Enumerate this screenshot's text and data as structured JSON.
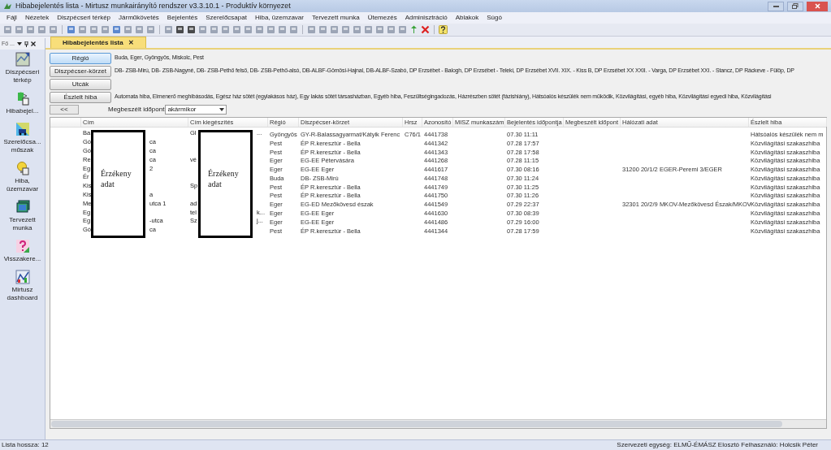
{
  "window": {
    "title": "Hibabejelentés lista - Mirtusz munkairányító rendszer v3.3.10.1 - Produktív környezet"
  },
  "menu": [
    "Fájl",
    "Nézetek",
    "Diszpécseri térkép",
    "Járműkövetés",
    "Bejelentés",
    "Szerelőcsapat",
    "Hiba, üzemzavar",
    "Tervezett munka",
    "Ütemezés",
    "Adminisztráció",
    "Ablakok",
    "Súgó"
  ],
  "sidebar": {
    "title": "Fő ...",
    "items": [
      {
        "label": "Diszpécseri térkép",
        "kind": "map"
      },
      {
        "label": "Hibabejel...",
        "kind": "report"
      },
      {
        "label": "Szerelőcsa... műszak",
        "kind": "truck"
      },
      {
        "label": "Hiba, üzemzavar",
        "kind": "bulb"
      },
      {
        "label": "Tervezett munka",
        "kind": "layers"
      },
      {
        "label": "Visszakere...",
        "kind": "question"
      },
      {
        "label": "Mirtusz dashboard",
        "kind": "chart"
      }
    ]
  },
  "tabs": [
    {
      "label": "Hibabejelentés lista",
      "selected": true,
      "close": "✕"
    }
  ],
  "filters": [
    {
      "button": "Régió",
      "value": "Buda, Eger, Gyöngyös, Miskolc, Pest",
      "selected": true
    },
    {
      "button": "Diszpécser-körzet",
      "value": "DB- ZSB-Mirú, DB- ZSB-Nagyné, DB- ZSB-Pethő felső, DB- ZSB-Pethő-alsó, DB-ALBF-Gömösi-Hajnal, DB-ALBF-Szabó, DP Erzsébet - Balogh, DP Erzsébet - Teleki, DP Erzsébet XVII. XIX. - Kiss B, DP Erzsébet XX XXII. - Varga, DP Erzsébet XXI. - Stancz, DP Ráckeve - Fülöp, DP",
      "selected": false
    },
    {
      "button": "Utcák",
      "selected": false
    },
    {
      "button": "Észlelt hiba",
      "value": "Automata hiba, Elmenerő meghibásodás, Egész ház sötét (egylakásos ház), Egy lakás sötét társasházban, Egyéb hiba, Feszültségingadozás, Házrészben sötét (fázishiány), Hátsóalós készülék nem működik, Közvilágítási, egyéb hiba, Közvilágítási egyedi hiba, Közvilágítási",
      "selected": false
    }
  ],
  "collapse_button": "<<",
  "date_filter": {
    "label": "Megbeszélt időpont",
    "value": "akármikor"
  },
  "table": {
    "columns": [
      "Cím",
      "Cím kiegészítés",
      "Régió",
      "Diszpécser-körzet",
      "Hrsz",
      "Azonosító",
      "MISZ munkaszám",
      "Bejelentés időpontja",
      "Megbeszélt időpont",
      "Hálózati adat",
      "Észlelt hiba"
    ],
    "rows": [
      {
        "cim": {
          "start": "Ba"
        },
        "kieg": {
          "start": "Gl",
          "end": "..."
        },
        "regio": "Gyöngyös",
        "korzet": "GY-R-Balassagyarmat/Kátyik Ferenc",
        "hrsz": "C76/1",
        "azon": "4441738",
        "bej": "07.30 11:11",
        "hiba": "Hátsóalós készülék nem m"
      },
      {
        "cim": {
          "start": "Gó",
          "end": "ca"
        },
        "regio": "Pest",
        "korzet": "ÉP R.keresztúr - Bella",
        "azon": "4441342",
        "bej": "07.28 17:57",
        "hiba": "Közvilágítási szakaszhiba"
      },
      {
        "cim": {
          "start": "Gó",
          "end": "ca"
        },
        "regio": "Pest",
        "korzet": "ÉP R.keresztúr - Bella",
        "azon": "4441343",
        "bej": "07.28 17:58",
        "hiba": "Közvilágítási szakaszhiba"
      },
      {
        "cim": {
          "start": "Re",
          "end": "ca"
        },
        "kieg": {
          "start": "vé"
        },
        "regio": "Eger",
        "korzet": "EG-EE Pétervására",
        "azon": "4441268",
        "bej": "07.28 11:15",
        "hiba": "Közvilágítási szakaszhiba"
      },
      {
        "cim": {
          "start": "Eg",
          "end": "2"
        },
        "regio": "Eger",
        "korzet": "EG-EE Eger",
        "azon": "4441617",
        "bej": "07.30 08:16",
        "halo": "31200 20/1/2 EGER-Peremi 3/EGER",
        "hiba": "Közvilágítási szakaszhiba"
      },
      {
        "cim": {
          "start": "Ér"
        },
        "regio": "Buda",
        "korzet": "DB- ZSB-Mirú",
        "azon": "4441748",
        "bej": "07.30 11:24",
        "hiba": "Közvilágítási szakaszhiba"
      },
      {
        "cim": {
          "start": "Kis"
        },
        "kieg": {
          "start": "Sp"
        },
        "regio": "Pest",
        "korzet": "ÉP R.keresztúr - Bella",
        "azon": "4441749",
        "bej": "07.30 11:25",
        "hiba": "Közvilágítási szakaszhiba"
      },
      {
        "cim": {
          "start": "Kis",
          "end": "a"
        },
        "regio": "Pest",
        "korzet": "ÉP R.keresztúr - Bella",
        "azon": "4441750",
        "bej": "07.30 11:26",
        "hiba": "Közvilágítási szakaszhiba"
      },
      {
        "cim": {
          "start": "Me",
          "end": "utca 1"
        },
        "kieg": {
          "start": "ad"
        },
        "regio": "Eger",
        "korzet": "EG-ED Mezőkövesd észak",
        "azon": "4441549",
        "bej": "07.29 22:37",
        "halo": "32301 20/2/9 MKOV-Mezőkövesd Észak/MKOV",
        "hiba": "Közvilágítási szakaszhiba"
      },
      {
        "cim": {
          "start": "Eg"
        },
        "kieg": {
          "start": "tel",
          "end": "k..."
        },
        "regio": "Eger",
        "korzet": "EG-EE Eger",
        "azon": "4441630",
        "bej": "07.30 08:39",
        "hiba": "Közvilágítási szakaszhiba"
      },
      {
        "cim": {
          "start": "Eg",
          "end": "-utca"
        },
        "kieg": {
          "start": "Sz",
          "end": "j..."
        },
        "regio": "Eger",
        "korzet": "EG-EE Eger",
        "azon": "4441486",
        "bej": "07.29 16:00",
        "hiba": "Közvilágítási szakaszhiba"
      },
      {
        "cim": {
          "start": "Gó",
          "end": "ca"
        },
        "regio": "Pest",
        "korzet": "ÉP R.keresztúr - Bella",
        "azon": "4441344",
        "bej": "07.28 17:59",
        "hiba": "Közvilágítási szakaszhiba"
      }
    ]
  },
  "redactions": [
    {
      "label": "Érzékeny adat"
    },
    {
      "label": "Érzékeny adat"
    }
  ],
  "status_bar": {
    "left": "Lista hossza: 12",
    "right": "Szervezeti egység: ELMŰ-ÉMÁSZ Elosztó  Felhasználó: Holcsik Péter"
  }
}
